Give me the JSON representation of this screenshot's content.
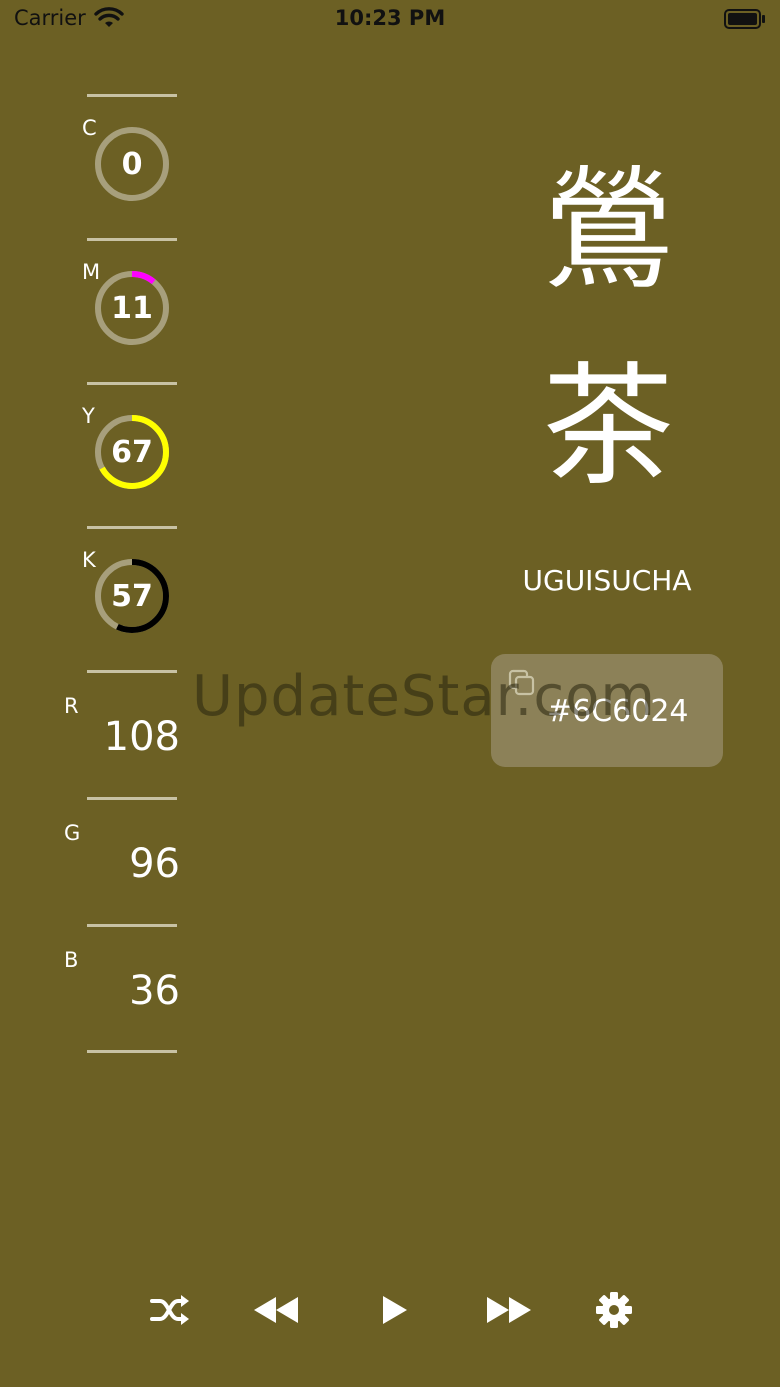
{
  "status_bar": {
    "carrier": "Carrier",
    "time": "10:23 PM"
  },
  "cmyk": [
    {
      "label": "C",
      "value": "0",
      "percent": 0,
      "color": "#00FFFF"
    },
    {
      "label": "M",
      "value": "11",
      "percent": 11,
      "color": "#FF00FF"
    },
    {
      "label": "Y",
      "value": "67",
      "percent": 67,
      "color": "#FFFF00"
    },
    {
      "label": "K",
      "value": "57",
      "percent": 57,
      "color": "#000000"
    }
  ],
  "rgb": [
    {
      "label": "R",
      "value": "108"
    },
    {
      "label": "G",
      "value": "96"
    },
    {
      "label": "B",
      "value": "36"
    }
  ],
  "color_name": {
    "kanji_1": "鶯",
    "kanji_2": "茶",
    "romaji": "UGUISUCHA",
    "hex": "#6C6024"
  },
  "watermark": "UpdateStar.com",
  "colors": {
    "background": "#6C6024",
    "ring_track": "#A79F7C",
    "divider": "#C8C2A4",
    "hex_box": "#8C8158"
  },
  "toolbar": {
    "shuffle": "shuffle-icon",
    "previous": "rewind-icon",
    "play": "play-icon",
    "next": "fast-forward-icon",
    "settings": "gear-icon"
  }
}
